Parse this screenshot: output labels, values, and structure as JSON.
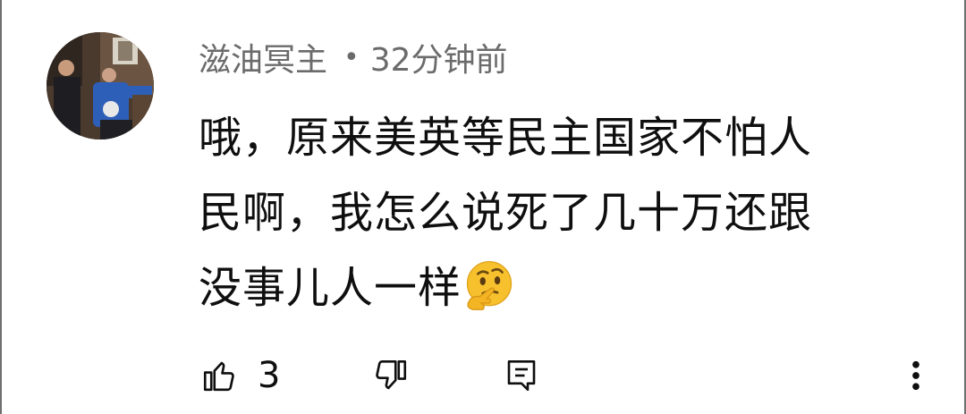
{
  "comment": {
    "author": "滋油冥主",
    "separator": "•",
    "time": "32分钟前",
    "text_lines": [
      "哦，原来美英等民主国家不怕人",
      "民啊，我怎么说死了几十万还跟",
      "没事儿人一样"
    ],
    "emoji": "thinking-face-emoji",
    "like_count": "3"
  },
  "icons": {
    "like": "thumbs-up-icon",
    "dislike": "thumbs-down-icon",
    "reply": "reply-comment-icon",
    "more": "more-vertical-icon"
  }
}
